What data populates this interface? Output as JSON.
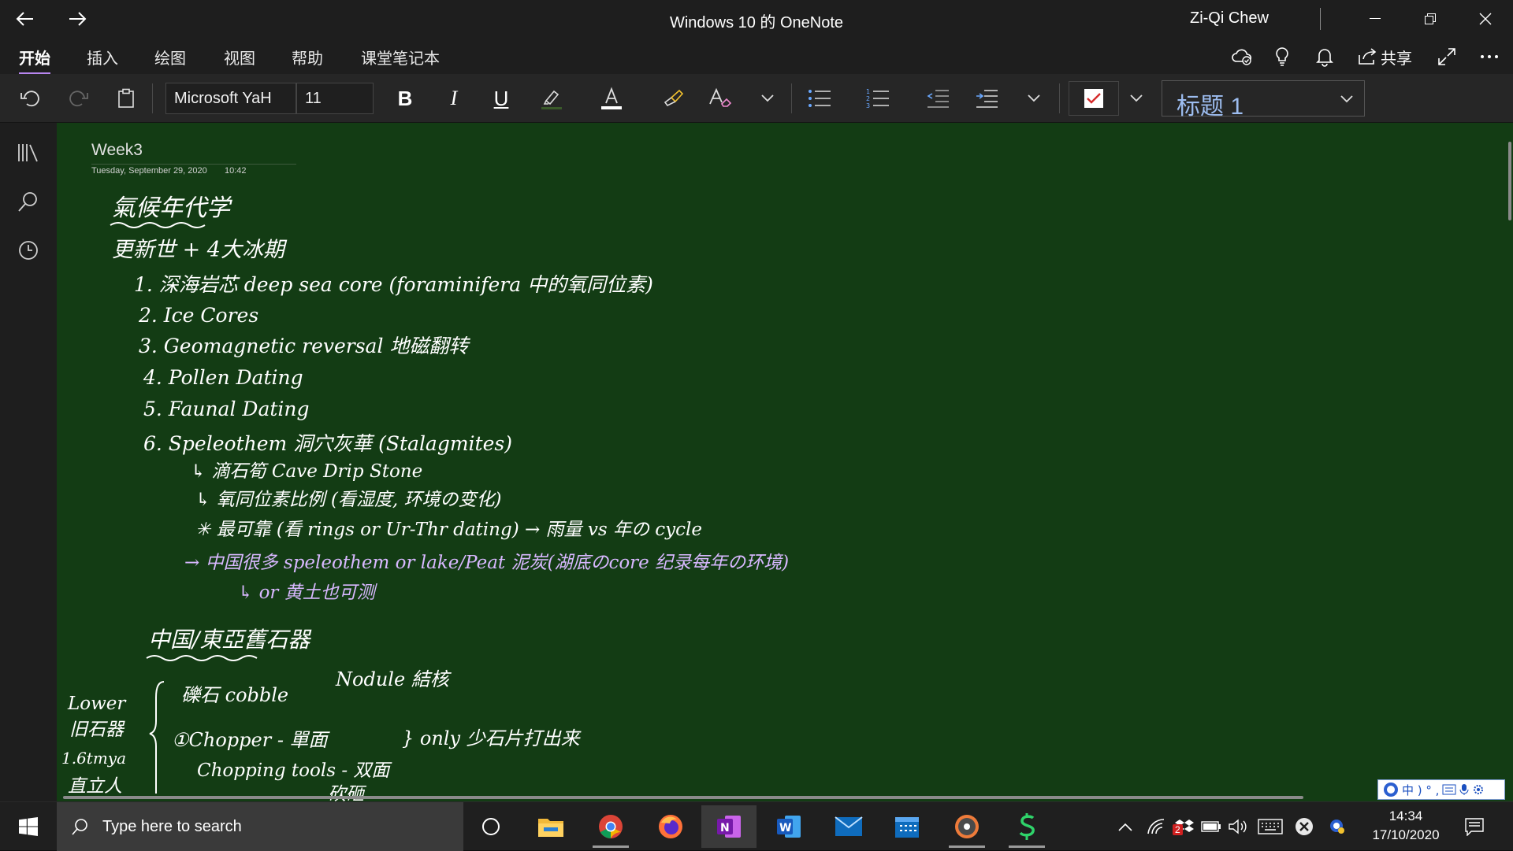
{
  "window": {
    "title": "Windows 10 的 OneNote",
    "user": "Zi-Qi Chew"
  },
  "ribbon": {
    "tabs": [
      "开始",
      "插入",
      "绘图",
      "视图",
      "帮助",
      "课堂笔记本"
    ],
    "active_tab": "开始",
    "share_label": "共享"
  },
  "toolbar": {
    "font_name": "Microsoft YaH",
    "font_size": "11",
    "style": "标题 1"
  },
  "page": {
    "title": "Week3",
    "date": "Tuesday, September 29, 2020",
    "time": "10:42"
  },
  "ink_notes": {
    "heading1": "氣候年代学",
    "line1": "更新世 + 4大冰期",
    "items": [
      "1. 深海岩芯 deep sea core (foraminifera 中的氧同位素)",
      "2. Ice Cores",
      "3. Geomagnetic reversal 地磁翻转",
      "4. Pollen Dating",
      "5. Faunal Dating",
      "6. Speleothem 洞穴灰華 (Stalagmites)"
    ],
    "sub1": "↳ 滴石筍 Cave Drip Stone",
    "sub2": "↳ 氧同位素比例 (看湿度, 环境の变化)",
    "sub3": "✳ 最可靠 (看 rings or Ur-Thr dating) → 雨量 vs 年の cycle",
    "purple1": "→ 中国很多 speleothem or lake/Peat 泥炭(湖底のcore 纪录每年の环境)",
    "purple2": "↳ or 黄土也可测",
    "heading2": "中国/東亞舊石器",
    "left_labels": [
      "Lower",
      "旧石器",
      "1.6tmya",
      "直立人"
    ],
    "row1a": "礫石 cobble",
    "row1b": "Nodule 結核",
    "row2": "①Chopper - 單面",
    "row3": "Chopping tools - 双面",
    "row_side": "} only 少石片打出来",
    "row4": "砍砸"
  },
  "taskbar": {
    "search_placeholder": "Type here to search",
    "time": "14:34",
    "date": "17/10/2020",
    "badge_count": "2"
  },
  "ime": {
    "text": "中 ) ° ,"
  },
  "colors": {
    "canvas": "#133c14",
    "chrome": "#1e1e1e",
    "accent": "#b886f0",
    "ink_white": "#ffffff",
    "ink_purple": "#d8b8ff",
    "style_text": "#9dbdf0"
  }
}
